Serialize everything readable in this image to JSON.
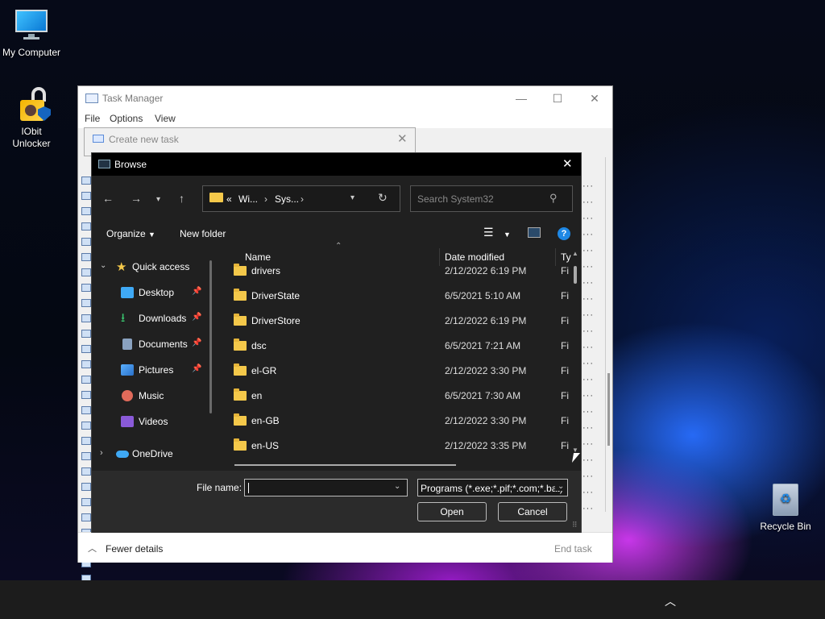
{
  "desktop": {
    "icons": [
      {
        "label": "My Computer"
      },
      {
        "label": "IObit Unlocker"
      },
      {
        "label": "Recycle Bin"
      }
    ]
  },
  "task_manager": {
    "title": "Task Manager",
    "menu": [
      "File",
      "Options",
      "View"
    ],
    "footer": {
      "fewer_details": "Fewer details",
      "end_task": "End task"
    }
  },
  "create_new_task": {
    "title": "Create new task"
  },
  "browse": {
    "title": "Browse",
    "address": {
      "root": "«",
      "crumb1": "Wi...",
      "crumb2": "Sys..."
    },
    "search_placeholder": "Search System32",
    "toolbar": {
      "organize": "Organize",
      "new_folder": "New folder",
      "help": "?"
    },
    "nav_pane": [
      {
        "label": "Quick access",
        "pinned": false
      },
      {
        "label": "Desktop",
        "pinned": true
      },
      {
        "label": "Downloads",
        "pinned": true
      },
      {
        "label": "Documents",
        "pinned": true
      },
      {
        "label": "Pictures",
        "pinned": true
      },
      {
        "label": "Music",
        "pinned": false
      },
      {
        "label": "Videos",
        "pinned": false
      },
      {
        "label": "OneDrive",
        "pinned": false
      }
    ],
    "columns": {
      "name": "Name",
      "date": "Date modified",
      "type": "Ty"
    },
    "files": [
      {
        "name": "drivers",
        "date": "2/12/2022 6:19 PM",
        "type": "Fi"
      },
      {
        "name": "DriverState",
        "date": "6/5/2021 5:10 AM",
        "type": "Fi"
      },
      {
        "name": "DriverStore",
        "date": "2/12/2022 6:19 PM",
        "type": "Fi"
      },
      {
        "name": "dsc",
        "date": "6/5/2021 7:21 AM",
        "type": "Fi"
      },
      {
        "name": "el-GR",
        "date": "2/12/2022 3:30 PM",
        "type": "Fi"
      },
      {
        "name": "en",
        "date": "6/5/2021 7:30 AM",
        "type": "Fi"
      },
      {
        "name": "en-GB",
        "date": "2/12/2022 3:30 PM",
        "type": "Fi"
      },
      {
        "name": "en-US",
        "date": "2/12/2022 3:35 PM",
        "type": "Fi"
      }
    ],
    "file_name_label": "File name:",
    "file_name_value": "",
    "file_type": "Programs (*.exe;*.pif;*.com;*.bat)",
    "open_button": "Open",
    "cancel_button": "Cancel"
  },
  "colors": {
    "accent": "#1e88e5",
    "folder": "#f4c84a",
    "dialog_bg": "#202020"
  }
}
